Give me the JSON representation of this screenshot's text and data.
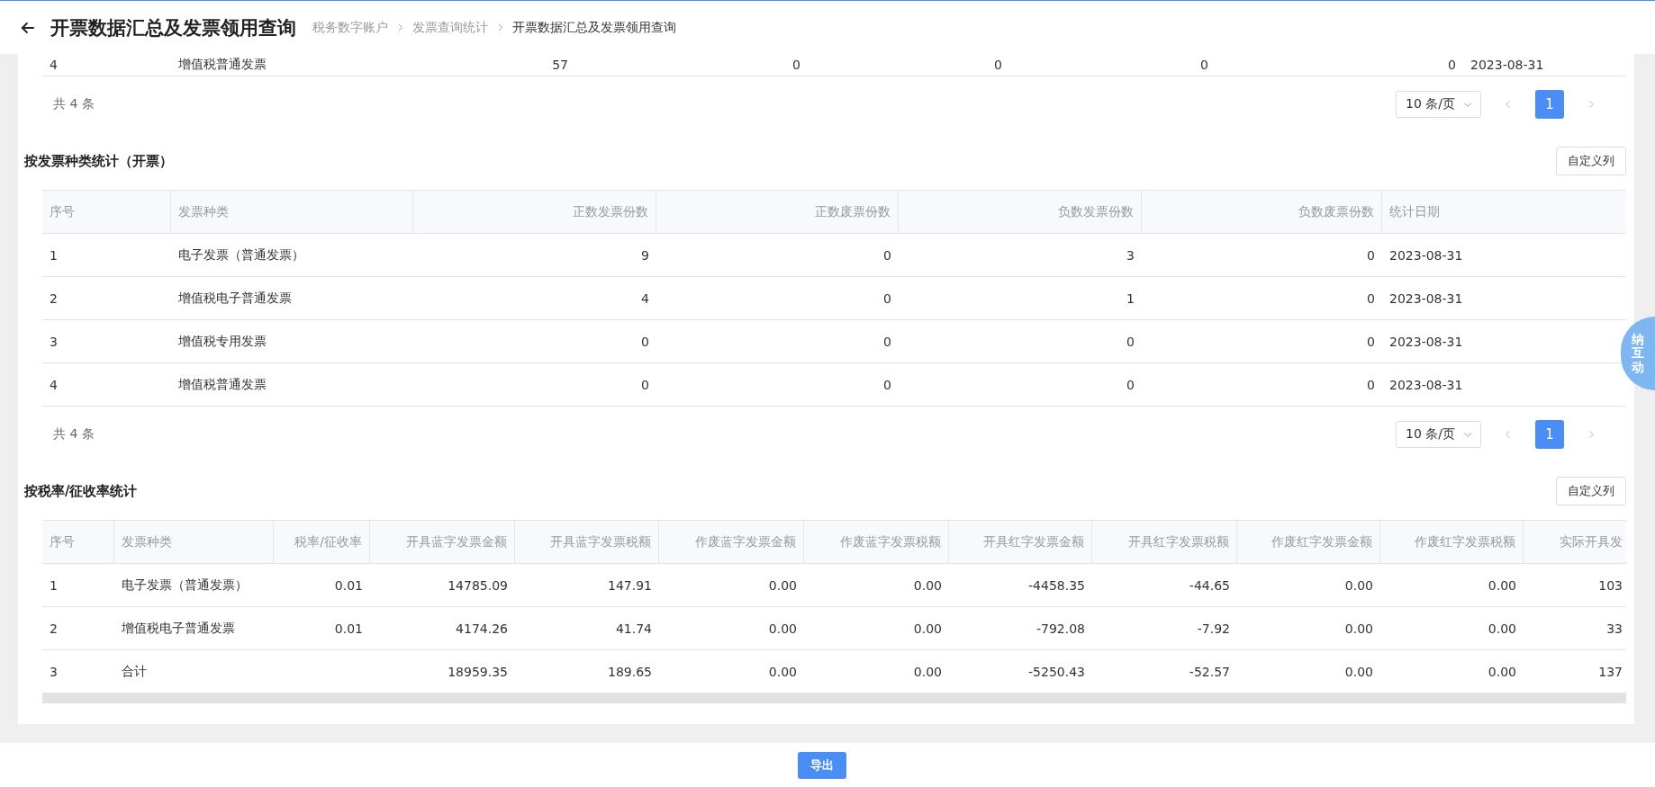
{
  "header": {
    "title": "开票数据汇总及发票领用查询",
    "breadcrumb": [
      "税务数字账户",
      "发票查询统计",
      "开票数据汇总及发票领用查询"
    ]
  },
  "summary_table": {
    "rows": [
      {
        "cells": [
          "4",
          "增值税普通发票",
          "57",
          "0",
          "0",
          "0",
          "0",
          "2023-08-31"
        ]
      }
    ],
    "total": "共 4 条",
    "page_size": "10 条/页",
    "pages": [
      {
        "label": "1",
        "selected": true
      }
    ]
  },
  "sections": [
    {
      "title": "按发票种类统计（开票）",
      "customize_button": "自定义列",
      "columns": [
        {
          "label": "序号",
          "kind": "text"
        },
        {
          "label": "发票种类",
          "kind": "text"
        },
        {
          "label": "正数发票份数",
          "kind": "number"
        },
        {
          "label": "正数废票份数",
          "kind": "number"
        },
        {
          "label": "负数发票份数",
          "kind": "number"
        },
        {
          "label": "负数废票份数",
          "kind": "number"
        },
        {
          "label": "统计日期",
          "kind": "text"
        }
      ],
      "rows": [
        {
          "cells": [
            "1",
            "电子发票（普通发票）",
            "9",
            "0",
            "3",
            "0",
            "2023-08-31"
          ]
        },
        {
          "cells": [
            "2",
            "增值税电子普通发票",
            "4",
            "0",
            "1",
            "0",
            "2023-08-31"
          ]
        },
        {
          "cells": [
            "3",
            "增值税专用发票",
            "0",
            "0",
            "0",
            "0",
            "2023-08-31"
          ]
        },
        {
          "cells": [
            "4",
            "增值税普通发票",
            "0",
            "0",
            "0",
            "0",
            "2023-08-31"
          ]
        }
      ],
      "total": "共 4 条",
      "page_size": "10 条/页",
      "pages": [
        {
          "label": "1",
          "selected": true
        }
      ]
    },
    {
      "title": "按税率/征收率统计",
      "customize_button": "自定义列",
      "columns": [
        {
          "label": "序号",
          "kind": "text"
        },
        {
          "label": "发票种类",
          "kind": "text"
        },
        {
          "label": "税率/征收率",
          "kind": "number"
        },
        {
          "label": "开具蓝字发票金额",
          "kind": "number"
        },
        {
          "label": "开具蓝字发票税额",
          "kind": "number"
        },
        {
          "label": "作废蓝字发票金额",
          "kind": "number"
        },
        {
          "label": "作废蓝字发票税额",
          "kind": "number"
        },
        {
          "label": "开具红字发票金额",
          "kind": "number"
        },
        {
          "label": "开具红字发票税额",
          "kind": "number"
        },
        {
          "label": "作废红字发票金额",
          "kind": "number"
        },
        {
          "label": "作废红字发票税额",
          "kind": "number"
        },
        {
          "label": "实际开具发",
          "kind": "number"
        }
      ],
      "rows": [
        {
          "cells": [
            "1",
            "电子发票（普通发票）",
            "0.01",
            "14785.09",
            "147.91",
            "0.00",
            "0.00",
            "-4458.35",
            "-44.65",
            "0.00",
            "0.00",
            "103"
          ]
        },
        {
          "cells": [
            "2",
            "增值税电子普通发票",
            "0.01",
            "4174.26",
            "41.74",
            "0.00",
            "0.00",
            "-792.08",
            "-7.92",
            "0.00",
            "0.00",
            "33"
          ]
        },
        {
          "cells": [
            "3",
            "合计",
            "",
            "18959.35",
            "189.65",
            "0.00",
            "0.00",
            "-5250.43",
            "-52.57",
            "0.00",
            "0.00",
            "137"
          ]
        }
      ]
    }
  ],
  "floating_widget": {
    "text": "纳互动"
  },
  "footer": {
    "export_button": "导出"
  }
}
